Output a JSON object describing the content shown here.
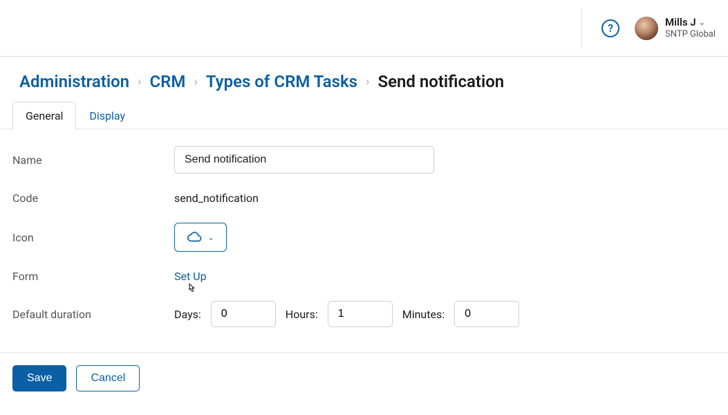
{
  "header": {
    "help_label": "?",
    "user_name": "Mills J",
    "user_org": "SNTP Global"
  },
  "breadcrumb": {
    "items": [
      "Administration",
      "CRM",
      "Types of CRM Tasks"
    ],
    "current": "Send notification"
  },
  "tabs": [
    {
      "label": "General",
      "active": true
    },
    {
      "label": "Display",
      "active": false
    }
  ],
  "form": {
    "name_label": "Name",
    "name_value": "Send notification",
    "code_label": "Code",
    "code_value": "send_notification",
    "icon_label": "Icon",
    "icon_name": "cloud",
    "form_label": "Form",
    "form_setup_label": "Set Up",
    "duration_label": "Default duration",
    "duration": {
      "days_label": "Days:",
      "days_value": "0",
      "hours_label": "Hours:",
      "hours_value": "1",
      "minutes_label": "Minutes:",
      "minutes_value": "0"
    }
  },
  "footer": {
    "save_label": "Save",
    "cancel_label": "Cancel"
  }
}
